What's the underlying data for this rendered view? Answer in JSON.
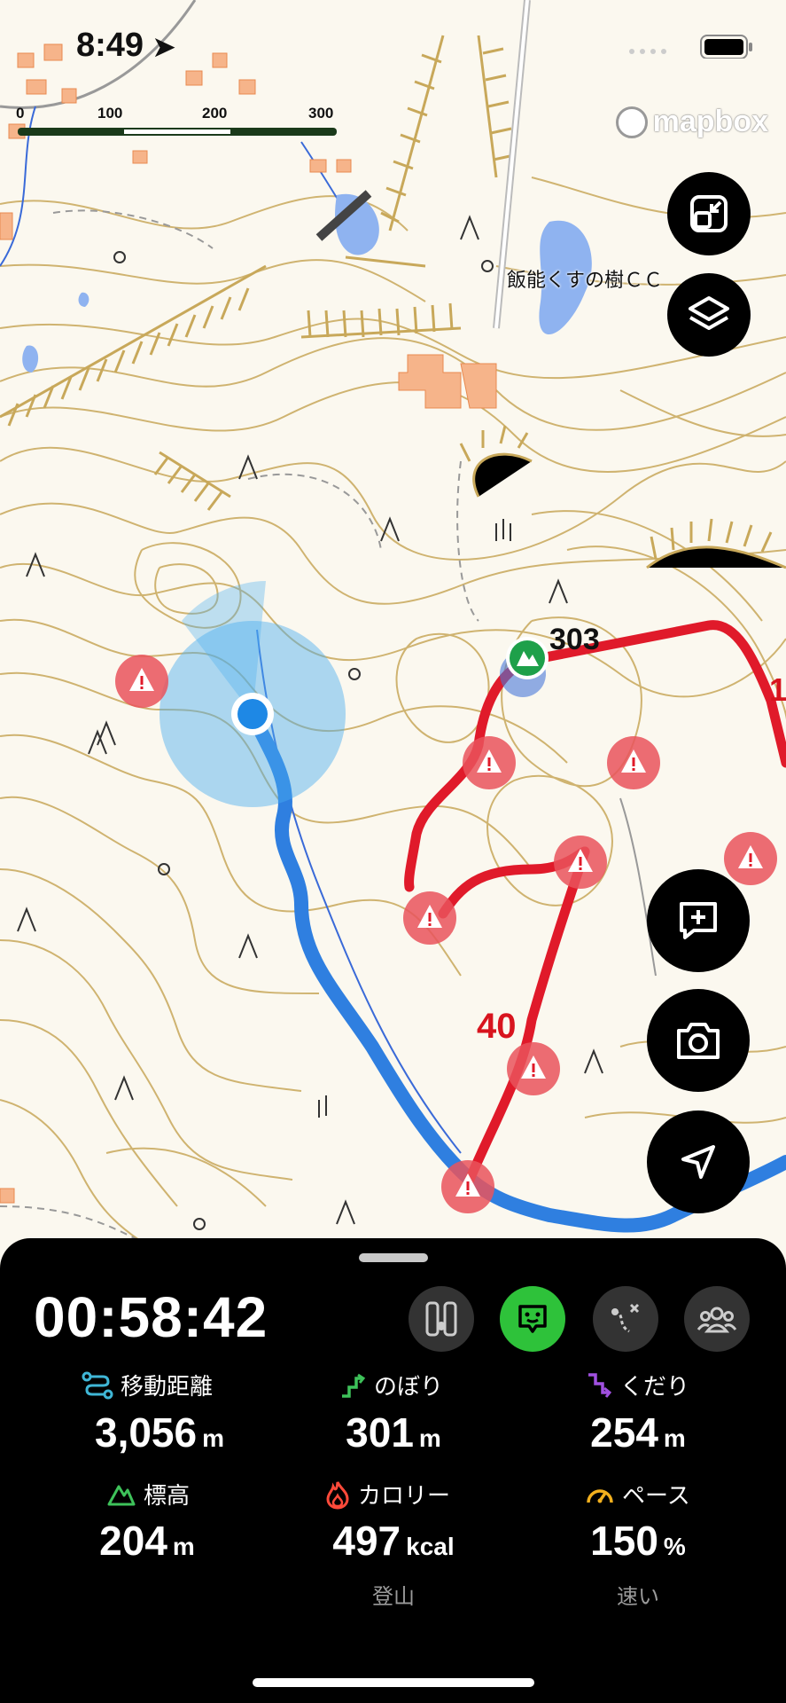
{
  "status": {
    "time": "8:49"
  },
  "scale": {
    "labels": [
      "0",
      "100 m",
      "200 m",
      "300 m"
    ]
  },
  "attribution": {
    "brand": "mapbox"
  },
  "map": {
    "place_label": "飯能くすの樹ＣＣ",
    "summit_elevation": "303",
    "distance_marker": "40"
  },
  "controls": {
    "icons": [
      "exit-fullscreen-icon",
      "layers-icon",
      "add-comment-icon",
      "camera-icon",
      "locate-arrow-icon"
    ]
  },
  "activity": {
    "timer": "00:58:42",
    "modes": [
      "hiking-gear-icon",
      "face-icon",
      "route-icon",
      "group-icon"
    ],
    "active_mode_color": "#2ec23a",
    "stats": {
      "distance": {
        "label": "移動距離",
        "value": "3,056",
        "unit": "m",
        "icon": "route-distance-icon",
        "icon_color": "#3fb6d6"
      },
      "ascent": {
        "label": "のぼり",
        "value": "301",
        "unit": "m",
        "icon": "ascent-icon",
        "icon_color": "#3ec25a"
      },
      "descent": {
        "label": "くだり",
        "value": "254",
        "unit": "m",
        "icon": "descent-icon",
        "icon_color": "#a050e0"
      },
      "elevation": {
        "label": "標高",
        "value": "204",
        "unit": "m",
        "icon": "mountain-icon",
        "icon_color": "#3ec25a"
      },
      "calories": {
        "label": "カロリー",
        "value": "497",
        "unit": "kcal",
        "icon": "flame-icon",
        "icon_color": "#ff4a3a",
        "sub": "登山"
      },
      "pace": {
        "label": "ペース",
        "value": "150",
        "unit": "%",
        "icon": "speedometer-icon",
        "icon_color": "#f2b01e",
        "sub": "速い"
      }
    }
  }
}
